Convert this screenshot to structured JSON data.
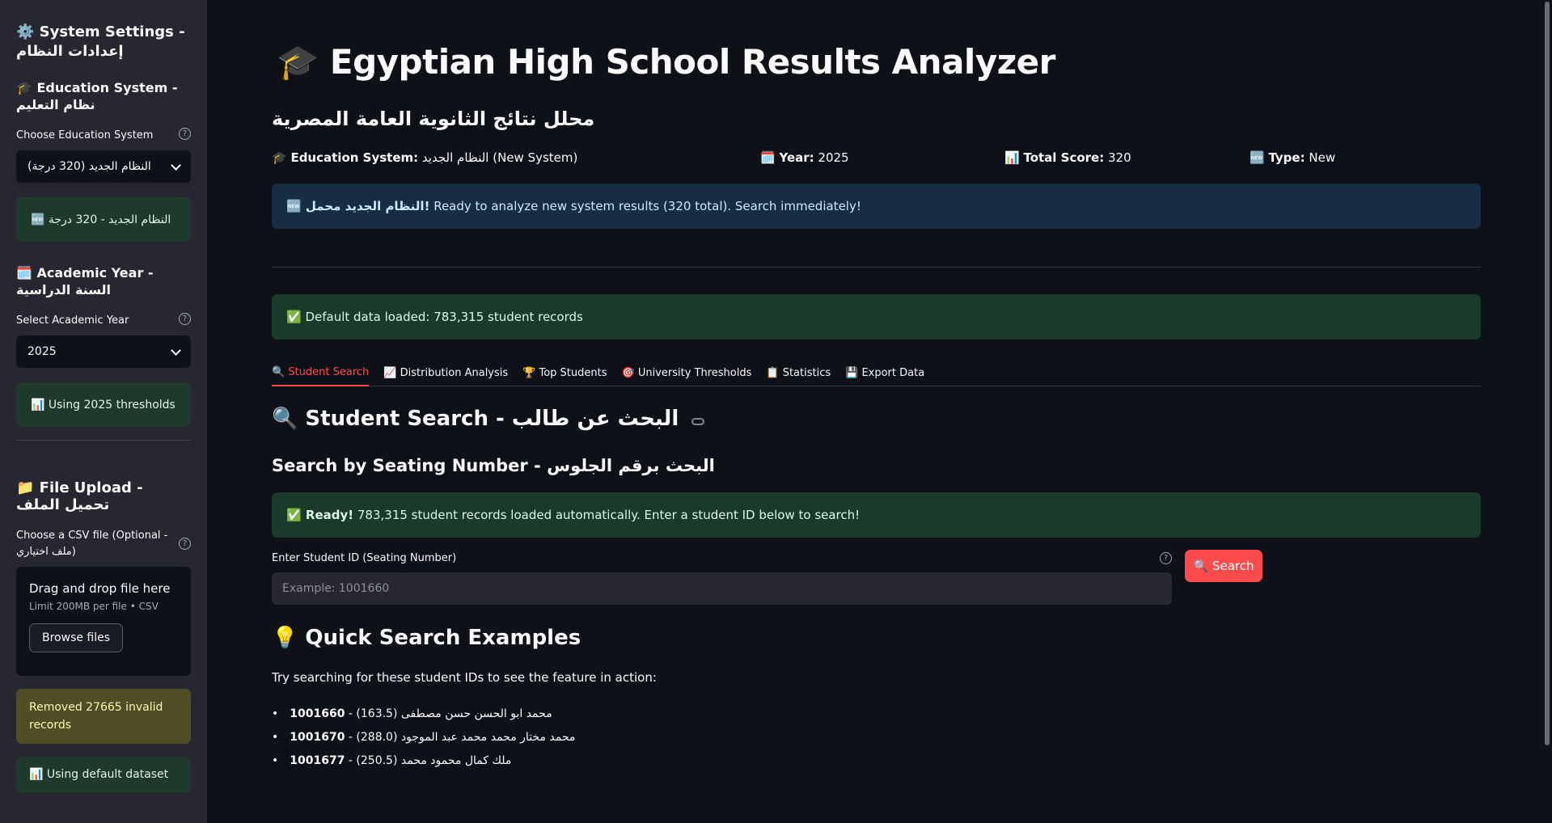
{
  "sidebar": {
    "title": "⚙️ System Settings - إعدادات النظام",
    "education": {
      "heading": "🎓 Education System - نظام التعليم",
      "label": "Choose Education System",
      "selected": "النظام الجديد (320 درجة)",
      "status": "🆕 النظام الجديد - 320 درجة"
    },
    "year": {
      "heading": "🗓️ Academic Year - السنة الدراسية",
      "label": "Select Academic Year",
      "selected": "2025",
      "status": "📊 Using 2025 thresholds"
    },
    "upload": {
      "heading": "📁 File Upload - تحميل الملف",
      "label": "Choose a CSV file (Optional - ملف اختياري)",
      "drop_text": "Drag and drop file here",
      "limit_text": "Limit 200MB per file • CSV",
      "browse_label": "Browse files",
      "warning": "Removed 27665 invalid records",
      "default_status": "📊 Using default dataset"
    }
  },
  "main": {
    "title": "🎓 Egyptian High School Results Analyzer",
    "subtitle_ar": "محلل نتائج الثانوية العامة المصرية",
    "meta": {
      "education_label": "Education System:",
      "education_value": "النظام الجديد (New System)",
      "year_label": "Year:",
      "year_value": "2025",
      "total_label": "Total Score:",
      "total_value": "320",
      "type_label": "Type:",
      "type_value": "New"
    },
    "info_strong": "🆕 النظام الجديد محمل!",
    "info_text": " Ready to analyze new system results (320 total). Search immediately!",
    "loaded_msg": "✅ Default data loaded: 783,315 student records",
    "tabs": [
      "🔍 Student Search",
      "📈 Distribution Analysis",
      "🏆 Top Students",
      "🎯 University Thresholds",
      "📋 Statistics",
      "💾 Export Data"
    ],
    "search_heading": "🔍 Student Search - البحث عن طالب",
    "search_subheading": "Search by Seating Number - البحث برقم الجلوس",
    "ready_strong": "✅ Ready!",
    "ready_text": " 783,315 student records loaded automatically. Enter a student ID below to search!",
    "input_label": "Enter Student ID (Seating Number)",
    "input_placeholder": "Example: 1001660",
    "search_button": "🔍 Search",
    "quick_heading": "💡 Quick Search Examples",
    "try_text": "Try searching for these student IDs to see the feature in action:",
    "examples": [
      {
        "id": "1001660",
        "rest": " - (163.5) محمد ابو الحسن حسن مصطفى"
      },
      {
        "id": "1001670",
        "rest": " - (288.0) محمد مختار محمد محمد عبد الموجود"
      },
      {
        "id": "1001677",
        "rest": " - (250.5) ملك كمال محمود محمد"
      }
    ]
  },
  "icons": {
    "help": "help-circle-icon",
    "chevron": "chevron-down-icon",
    "link": "link-icon"
  },
  "colors": {
    "accent": "#ff4b4b",
    "background": "#0e1117",
    "sidebar": "#262730",
    "info": "#172d43",
    "success": "#1a3a2a",
    "warning": "#514d27"
  }
}
